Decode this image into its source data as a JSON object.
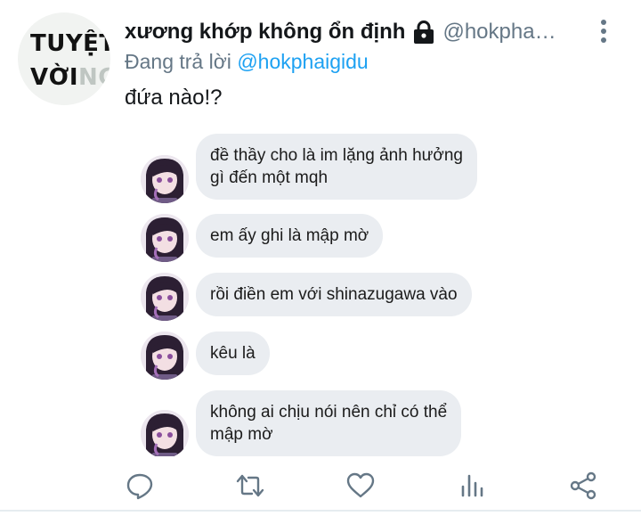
{
  "profile": {
    "avatar_line1": "TUYỆT",
    "avatar_line2_main": "VỜI",
    "avatar_line2_fade": "NG"
  },
  "header": {
    "display_name": "xương khớp không ổn định",
    "lock_icon": "lock-icon",
    "handle": "@hokpha…",
    "more_icon": "more-vertical-icon"
  },
  "reply": {
    "prefix": "Đang trả lời",
    "handle": "@hokphaigidu"
  },
  "tweet_text": "đứa nào!?",
  "chat": {
    "messages": [
      {
        "line1": "đề thầy cho là im lặng ảnh hưởng",
        "line2": "gì đến một mqh"
      },
      {
        "line1": "em ấy ghi là mập mờ",
        "line2": ""
      },
      {
        "line1": "rồi điền em với shinazugawa vào",
        "line2": ""
      },
      {
        "line1": "kêu là",
        "line2": ""
      },
      {
        "line1": "không ai chịu nói nên chỉ có thể",
        "line2": "mập mờ"
      }
    ]
  },
  "actions": {
    "reply_icon": "reply-icon",
    "retweet_icon": "retweet-icon",
    "like_icon": "heart-icon",
    "analytics_icon": "analytics-icon",
    "share_icon": "share-icon"
  },
  "colors": {
    "link": "#1da1f2",
    "secondary_text": "#657786",
    "icon": "#657786",
    "bubble": "#eaedf1"
  }
}
